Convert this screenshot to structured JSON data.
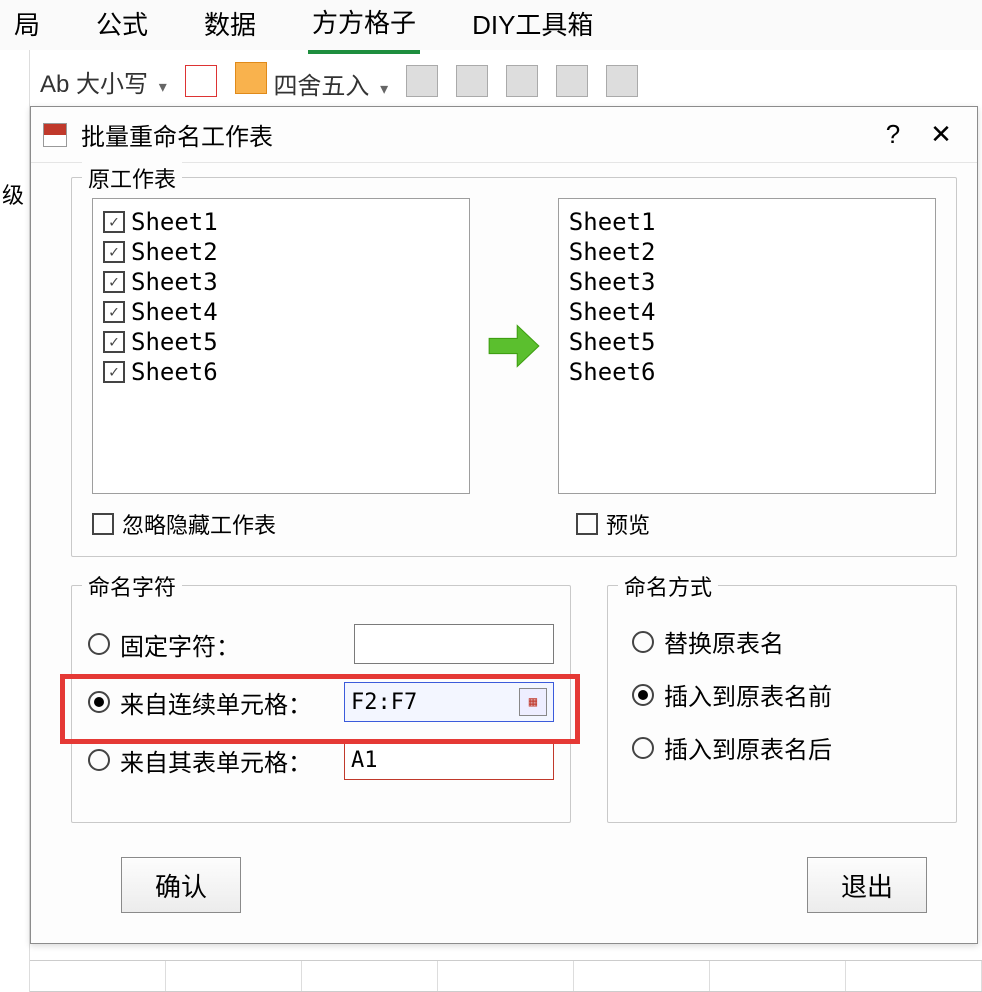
{
  "ribbon": {
    "tabs": [
      "局",
      "公式",
      "数据",
      "方方格子",
      "DIY工具箱"
    ],
    "active_index": 3,
    "case_label": "Ab 大小写",
    "round_label": "四舍五入"
  },
  "side_label": "级",
  "dialog": {
    "title": "批量重命名工作表",
    "group_source": "原工作表",
    "source_sheets": [
      {
        "name": "Sheet1",
        "checked": true
      },
      {
        "name": "Sheet2",
        "checked": true
      },
      {
        "name": "Sheet3",
        "checked": true
      },
      {
        "name": "Sheet4",
        "checked": true
      },
      {
        "name": "Sheet5",
        "checked": true
      },
      {
        "name": "Sheet6",
        "checked": true
      }
    ],
    "preview_sheets": [
      "Sheet1",
      "Sheet2",
      "Sheet3",
      "Sheet4",
      "Sheet5",
      "Sheet6"
    ],
    "ignore_hidden_label": "忽略隐藏工作表",
    "preview_label": "预览",
    "group_naming": "命名字符",
    "opt_fixed": "固定字符：",
    "opt_range": "来自连续单元格：",
    "opt_other": "来自其表单元格：",
    "range_value": "F2:F7",
    "other_value": "A1",
    "group_method": "命名方式",
    "opt_replace": "替换原表名",
    "opt_before": "插入到原表名前",
    "opt_after": "插入到原表名后",
    "btn_ok": "确认",
    "btn_exit": "退出"
  }
}
